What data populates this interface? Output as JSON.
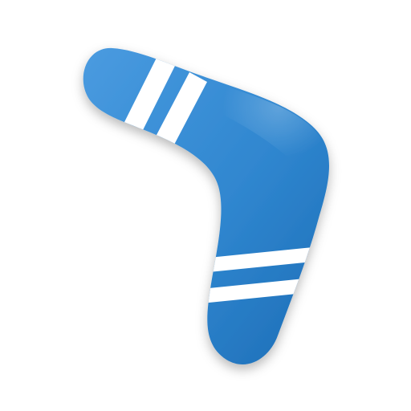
{
  "app_icon": {
    "icon": "boomerang-icon",
    "colors": {
      "background": "#ffffff",
      "body_main": "#2f86cf",
      "body_light": "#4a9be0",
      "body_dark": "#1d6db6",
      "stripe": "#ffffff"
    }
  }
}
